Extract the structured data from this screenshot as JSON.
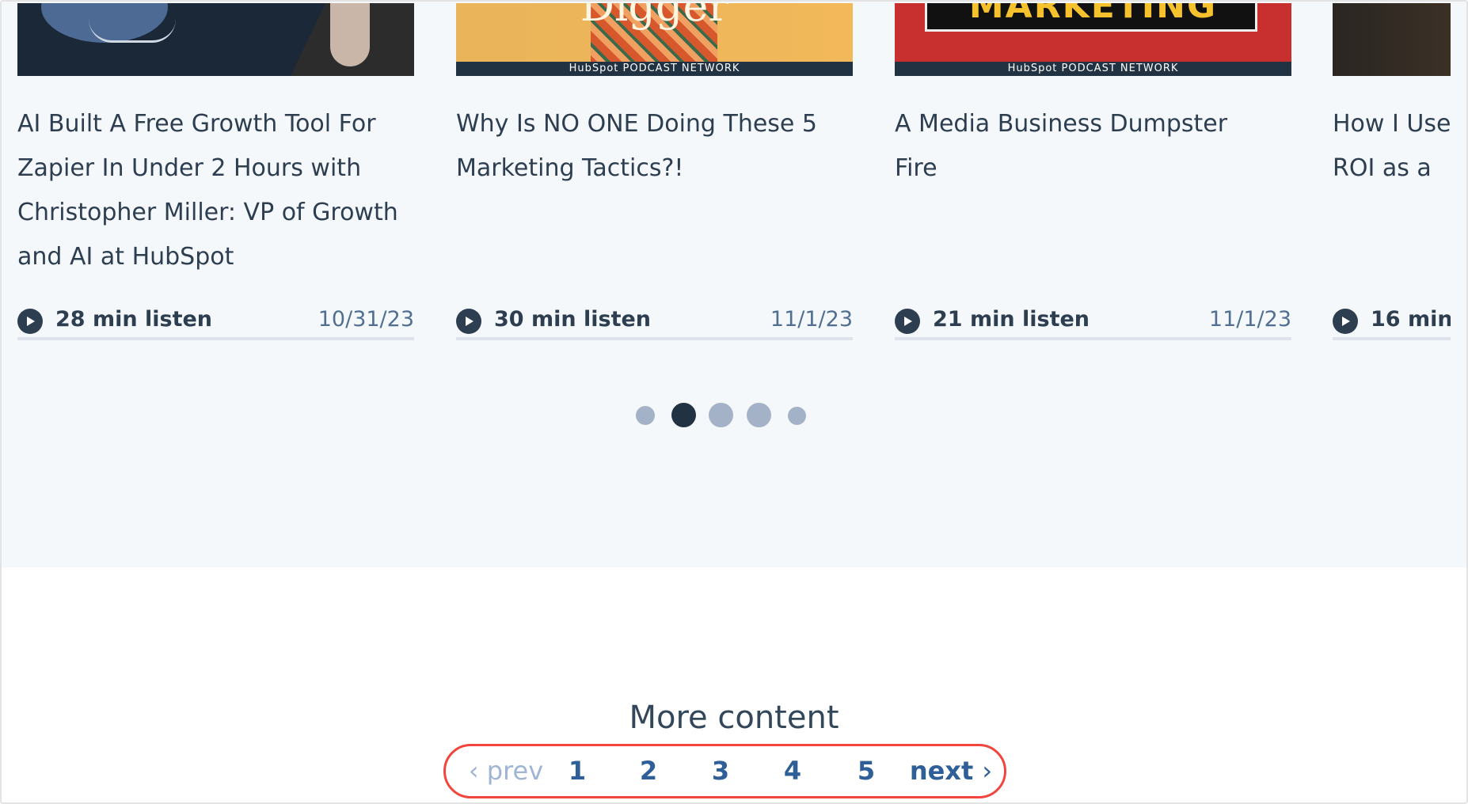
{
  "cards": [
    {
      "title": "AI Built A Free Growth Tool For Zapier In Under 2 Hours with Christopher Miller: VP of Growth and AI at HubSpot",
      "duration": "28 min listen",
      "date": "10/31/23",
      "thumb_colors": [
        "#1b2838",
        "#3a3a3a"
      ]
    },
    {
      "title": "Why Is NO ONE Doing These 5 Marketing Tactics?!",
      "duration": "30 min listen",
      "date": "11/1/23",
      "thumb_colors": [
        "#e9b45a",
        "#f2b85a"
      ],
      "thumb_text": "Digger",
      "network": "HubSpot PODCAST NETWORK"
    },
    {
      "title": "A Media Business Dumpster Fire",
      "duration": "21 min listen",
      "date": "11/1/23",
      "thumb_colors": [
        "#c8302f",
        "#b72a2a"
      ],
      "thumb_text": "MARKETING",
      "network": "HubSpot PODCAST NETWORK"
    },
    {
      "title": "How I Use ROI as a",
      "duration": "16 min",
      "date": "",
      "thumb_colors": [
        "#2a2622",
        "#3b3026"
      ]
    }
  ],
  "carousel": {
    "dots": 5,
    "active": 2
  },
  "more": {
    "heading": "More content",
    "prev": "prev",
    "pages": [
      "1",
      "2",
      "3",
      "4",
      "5"
    ],
    "next": "next",
    "highlight_color": "#f2453d"
  }
}
